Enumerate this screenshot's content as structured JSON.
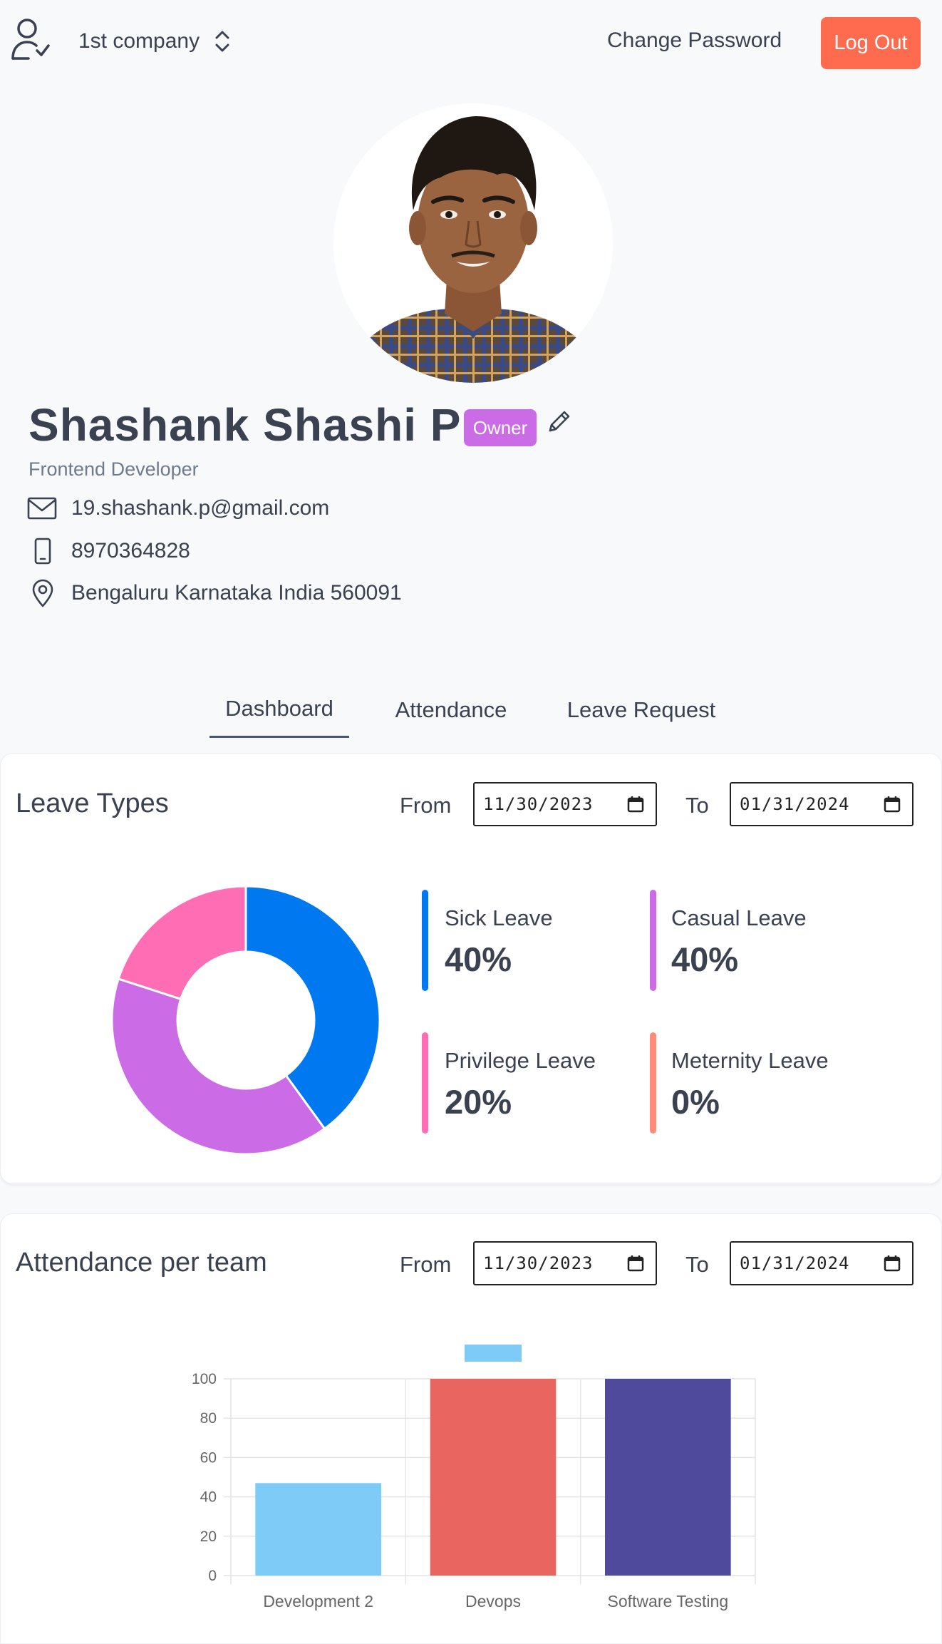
{
  "header": {
    "company": "1st company",
    "change_password": "Change Password",
    "logout": "Log Out"
  },
  "profile": {
    "name": "Shashank Shashi P",
    "badge": "Owner",
    "role": "Frontend Developer",
    "email": "19.shashank.p@gmail.com",
    "phone": "8970364828",
    "address": "Bengaluru Karnataka India 560091"
  },
  "tabs": [
    {
      "label": "Dashboard",
      "active": true
    },
    {
      "label": "Attendance",
      "active": false
    },
    {
      "label": "Leave Request",
      "active": false
    }
  ],
  "leave_card": {
    "title": "Leave Types",
    "from_label": "From",
    "to_label": "To",
    "from_date": "11/30/2023",
    "to_date": "01/31/2024"
  },
  "attendance_card": {
    "title": "Attendance per team",
    "from_label": "From",
    "to_label": "To",
    "from_date": "11/30/2023",
    "to_date": "01/31/2024"
  },
  "legend": [
    {
      "name": "Sick Leave",
      "value": "40%",
      "color": "#0078f0"
    },
    {
      "name": "Casual Leave",
      "value": "40%",
      "color": "#cb6ce6"
    },
    {
      "name": "Privilege Leave",
      "value": "20%",
      "color": "#ff6eb4"
    },
    {
      "name": "Meternity Leave",
      "value": "0%",
      "color": "#ff8b7b"
    }
  ],
  "chart_data": [
    {
      "type": "pie",
      "variant": "doughnut",
      "labels": [
        "Sick Leave",
        "Casual Leave",
        "Privilege Leave",
        "Meternity Leave"
      ],
      "values": [
        40,
        40,
        20,
        0
      ],
      "colors": [
        "#0078f0",
        "#cb6ce6",
        "#ff6eb4",
        "#ff8b7b"
      ]
    },
    {
      "type": "bar",
      "categories": [
        "Development 2",
        "Devops",
        "Software Testing"
      ],
      "values": [
        47,
        100,
        100
      ],
      "colors": [
        "#7ecbf7",
        "#e8665f",
        "#4f4a9c"
      ],
      "ylim": [
        0,
        100
      ],
      "yticks": [
        "0",
        "20",
        "40",
        "60",
        "80",
        "100"
      ],
      "grid": true,
      "legend_color": "#7ecbf7"
    }
  ]
}
